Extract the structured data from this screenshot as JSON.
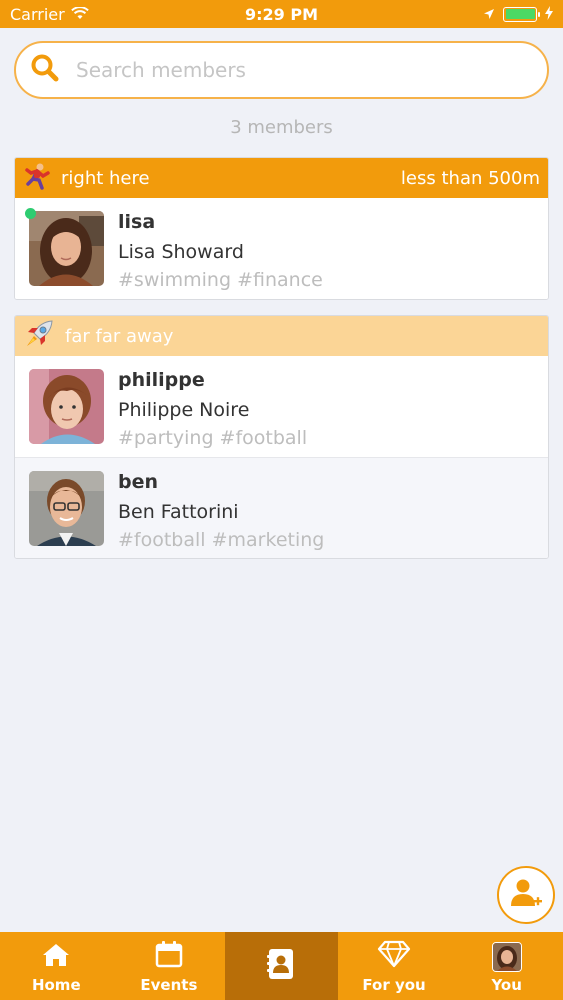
{
  "status_bar": {
    "carrier": "Carrier",
    "time": "9:29 PM",
    "battery_level": 1.0
  },
  "search": {
    "placeholder": "Search members",
    "value": ""
  },
  "member_count": "3 members",
  "sections": [
    {
      "title": "right here",
      "distance": "less than 500m",
      "icon": "running-person-icon",
      "members": [
        {
          "username": "lisa",
          "full_name": "Lisa Showard",
          "tags": "#swimming #finance",
          "online": true
        }
      ]
    },
    {
      "title": "far far away",
      "icon": "rocket-icon",
      "members": [
        {
          "username": "philippe",
          "full_name": "Philippe Noire",
          "tags": "#partying #football",
          "online": false
        },
        {
          "username": "ben",
          "full_name": "Ben Fattorini",
          "tags": "#football #marketing",
          "online": false
        }
      ]
    }
  ],
  "tabs": [
    {
      "label": "Home",
      "icon": "home-icon"
    },
    {
      "label": "Events",
      "icon": "calendar-icon"
    },
    {
      "label": "",
      "icon": "contacts-icon",
      "active": true
    },
    {
      "label": "For you",
      "icon": "diamond-icon"
    },
    {
      "label": "You",
      "icon": "avatar"
    }
  ],
  "colors": {
    "accent": "#f29b0c",
    "accent_light": "#fbd596",
    "active_tab": "#b86e08",
    "background": "#eff1f7",
    "online": "#2ecc71"
  }
}
